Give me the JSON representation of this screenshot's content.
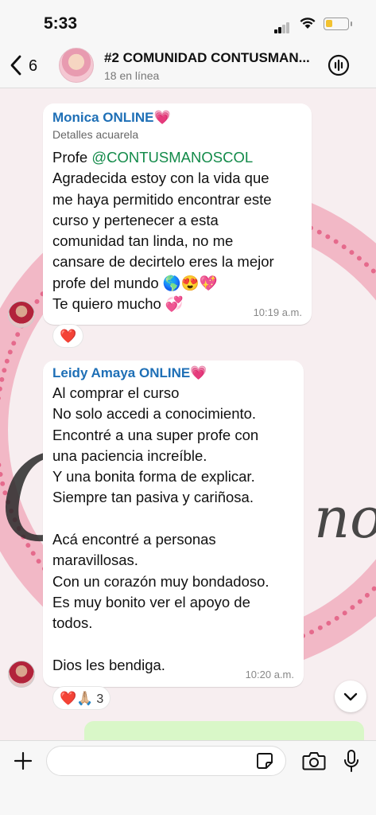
{
  "status_bar": {
    "time": "5:33"
  },
  "header": {
    "back_count": "6",
    "title": "#2 COMUNIDAD CONTUSMAN...",
    "subtitle": "18 en línea"
  },
  "wallpaper": {
    "script_left": "C",
    "script_right": "nos"
  },
  "messages": [
    {
      "sender": "Monica ONLINE",
      "sender_emoji": "💗",
      "reply_line": "Detalles acuarela",
      "mention_prefix": "Profe ",
      "mention": "@CONTUSMANOSCOL",
      "lines": [
        "Agradecida estoy con la vida que",
        "me haya permitido encontrar este",
        "curso y pertenecer a esta",
        "comunidad tan linda, no me",
        "cansare de decirtelo eres la mejor",
        "profe del mundo 🌎😍💖",
        "Te quiero mucho 💞"
      ],
      "time": "10:19 a.m.",
      "reaction": "❤️"
    },
    {
      "sender": "Leidy Amaya ONLINE",
      "sender_emoji": "💗",
      "lines": [
        "Al comprar el curso",
        "No solo  accedi a conocimiento.",
        "Encontré  a una super profe con",
        "una paciencia increíble.",
        "Y una bonita forma de explicar.",
        "Siempre tan pasiva y cariñosa.",
        "",
        "Acá encontré a personas",
        "maravillosas.",
        "Con un corazón muy bondadoso.",
        "Es muy bonito ver el apoyo de",
        "todos.",
        "",
        "Dios les bendiga."
      ],
      "time": "10:20 a.m.",
      "reaction": "❤️🙏🏼",
      "reaction_count": "3"
    }
  ],
  "input": {
    "placeholder": ""
  },
  "colors": {
    "sender": "#1e6fb6",
    "mention": "#128a49",
    "wallpaper_pink": "#f2b8c6"
  }
}
